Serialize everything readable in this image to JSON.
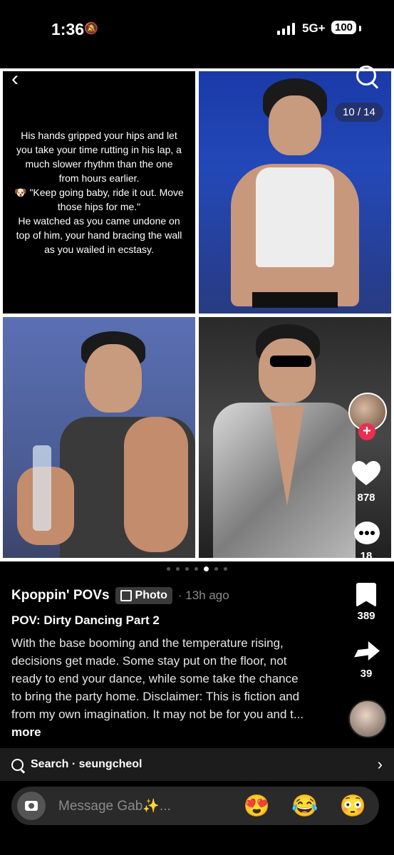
{
  "status": {
    "time": "1:36",
    "network": "5G+",
    "battery": "100"
  },
  "carousel": {
    "counter": "10 / 14",
    "caption": "His hands gripped your hips and let you take your time rutting in his lap, a much slower rhythm than the one from hours earlier.\n🐶 \"Keep going baby, ride it out. Move those hips for me.\"\nHe watched as you came undone on top of him, your hand bracing the wall as you wailed in ecstasy.",
    "dots_total": 7,
    "dots_active_index": 4
  },
  "actions": {
    "likes": "878",
    "comments": "18",
    "bookmarks": "389",
    "shares": "39"
  },
  "post": {
    "author": "Kpoppin' POVs",
    "badge": "Photo",
    "time_ago": "· 13h ago",
    "title": "POV: Dirty Dancing Part 2",
    "description": "With the base booming and the temperature rising, decisions get made. Some stay put on the floor, not ready to end your dance, while some take the chance to bring the party home. Disclaimer: This is fiction and from my own imagination. It may not be for you and t...",
    "more": "more"
  },
  "search": {
    "label": "Search · seungcheol"
  },
  "composer": {
    "placeholder": "Message Gab✨...",
    "emojis": [
      "😍",
      "😂",
      "😳"
    ]
  }
}
